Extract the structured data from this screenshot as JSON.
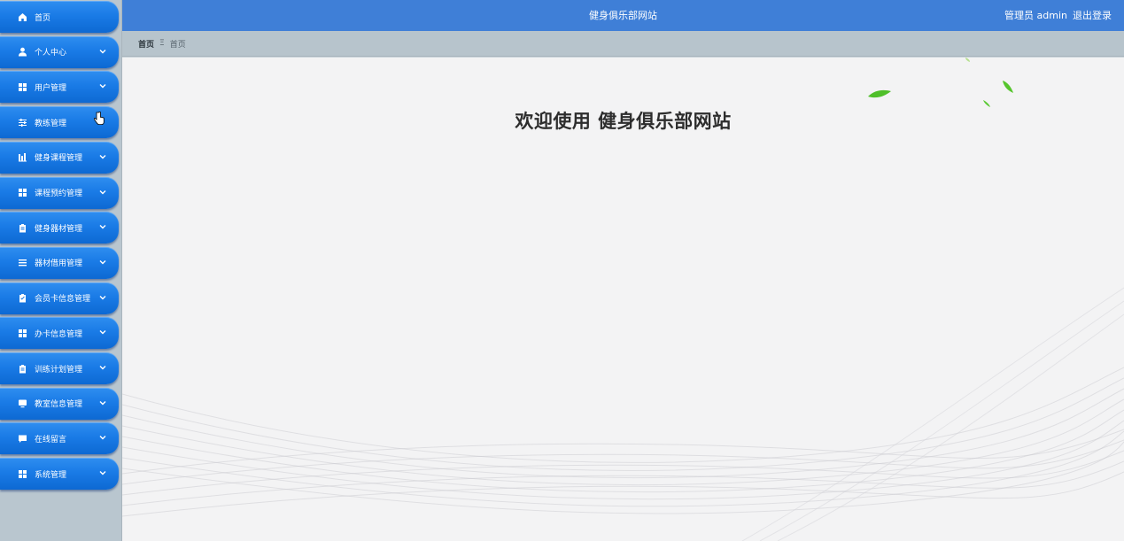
{
  "header": {
    "title": "健身俱乐部网站",
    "role_label": "管理员 admin",
    "logout_label": "退出登录"
  },
  "breadcrumb": {
    "home": "首页",
    "separator": "Ξ",
    "current": "首页"
  },
  "main": {
    "welcome_text": "欢迎使用 健身俱乐部网站"
  },
  "sidebar": {
    "items": [
      {
        "label": "首页",
        "icon": "home-icon",
        "has_chevron": false
      },
      {
        "label": "个人中心",
        "icon": "user-icon",
        "has_chevron": true
      },
      {
        "label": "用户管理",
        "icon": "grid-icon",
        "has_chevron": true
      },
      {
        "label": "教练管理",
        "icon": "sliders-icon",
        "has_chevron": false
      },
      {
        "label": "健身课程管理",
        "icon": "bar-chart-icon",
        "has_chevron": true
      },
      {
        "label": "课程预约管理",
        "icon": "grid-icon",
        "has_chevron": true
      },
      {
        "label": "健身器材管理",
        "icon": "clipboard-icon",
        "has_chevron": true
      },
      {
        "label": "器材借用管理",
        "icon": "list-icon",
        "has_chevron": true
      },
      {
        "label": "会员卡信息管理",
        "icon": "clipboard-check-icon",
        "has_chevron": true
      },
      {
        "label": "办卡信息管理",
        "icon": "grid-icon",
        "has_chevron": true
      },
      {
        "label": "训练计划管理",
        "icon": "clipboard-icon",
        "has_chevron": true
      },
      {
        "label": "教室信息管理",
        "icon": "monitor-icon",
        "has_chevron": true
      },
      {
        "label": "在线留言",
        "icon": "message-icon",
        "has_chevron": true
      },
      {
        "label": "系统管理",
        "icon": "grid-icon",
        "has_chevron": true
      }
    ]
  },
  "colors": {
    "header_bg": "#3f7fd7",
    "menu_blue": "#1a7be6",
    "sidebar_bg": "#b9c6cf",
    "content_bg": "#f3f3f4"
  }
}
